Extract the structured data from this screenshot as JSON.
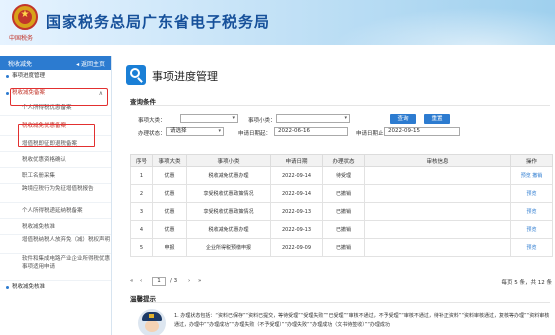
{
  "header": {
    "title": "国家税务总局广东省电子税务局",
    "seal_text": "中国税务"
  },
  "sidebar": {
    "section": "税收减免",
    "back": "返回主页",
    "items": [
      {
        "label": "事项进度管理"
      },
      {
        "label": "税收减免备案"
      },
      {
        "label": "个人所得税优惠备案"
      },
      {
        "label": "税收减免优惠备案"
      },
      {
        "label": "增值税即征即退税备案"
      },
      {
        "label": "税收优惠资格确认"
      },
      {
        "label": "职工名册采集"
      },
      {
        "label": "跨境应税行为免征增值税报告"
      },
      {
        "label": "个人所得税递延纳税备案"
      },
      {
        "label": "税收减免核准"
      },
      {
        "label": "增值税纳税人放弃免（减）税权声明"
      },
      {
        "label": "软件和集成电路产业企业所得税优惠事项适用申请"
      },
      {
        "label": "税收减免核准"
      }
    ]
  },
  "main": {
    "page_title": "事项进度管理",
    "conditions_label": "查询条件",
    "filters": {
      "item_category_label": "事项大类：",
      "item_subcategory_label": "事项小类：",
      "status_label": "办理状态：",
      "status_value": "请选择",
      "apply_start_label": "申请日期起：",
      "apply_start_value": "2022-06-16",
      "apply_end_label": "申请日期止：",
      "apply_end_value": "2022-09-15"
    },
    "buttons": {
      "query": "查询",
      "reset": "重置"
    },
    "table": {
      "headers": [
        "序号",
        "事项大类",
        "事项小类",
        "申请日期",
        "办理状态",
        "审核信息",
        "操作"
      ],
      "rows": [
        {
          "no": "1",
          "category": "优惠",
          "subcategory": "税收减免优惠办理",
          "date": "2022-09-14",
          "status": "待受理",
          "audit": "",
          "op": "预览  撤销"
        },
        {
          "no": "2",
          "category": "优惠",
          "subcategory": "享受税收优惠政策情况",
          "date": "2022-09-14",
          "status": "已撤销",
          "audit": "",
          "op": "预览"
        },
        {
          "no": "3",
          "category": "优惠",
          "subcategory": "享受税收优惠政策情况",
          "date": "2022-09-13",
          "status": "已撤销",
          "audit": "",
          "op": "预览"
        },
        {
          "no": "4",
          "category": "优惠",
          "subcategory": "税收减免优惠办理",
          "date": "2022-09-13",
          "status": "已撤销",
          "audit": "",
          "op": "预览"
        },
        {
          "no": "5",
          "category": "申报",
          "subcategory": "企业所得税预缴申报",
          "date": "2022-09-09",
          "status": "已撤销",
          "audit": "",
          "op": "预览"
        }
      ]
    },
    "pager": {
      "page": "1",
      "of": "/ 3",
      "info": "每页 5 条，共 12 条"
    },
    "tips_label": "温馨提示",
    "tip_text": "1. 办理状态包括：“资料已保存”“资料已提交，等待受理”“受理失败”“已受理”“审核不通过，不予受理”“审核不通过，待补正资料”“资料审核通过，复核等办理”“资料审核通过，办理中”“办理成功”“办理失败（不予受理）”“办理失败”“办理成功（文书待签收）”“办理成功"
  }
}
